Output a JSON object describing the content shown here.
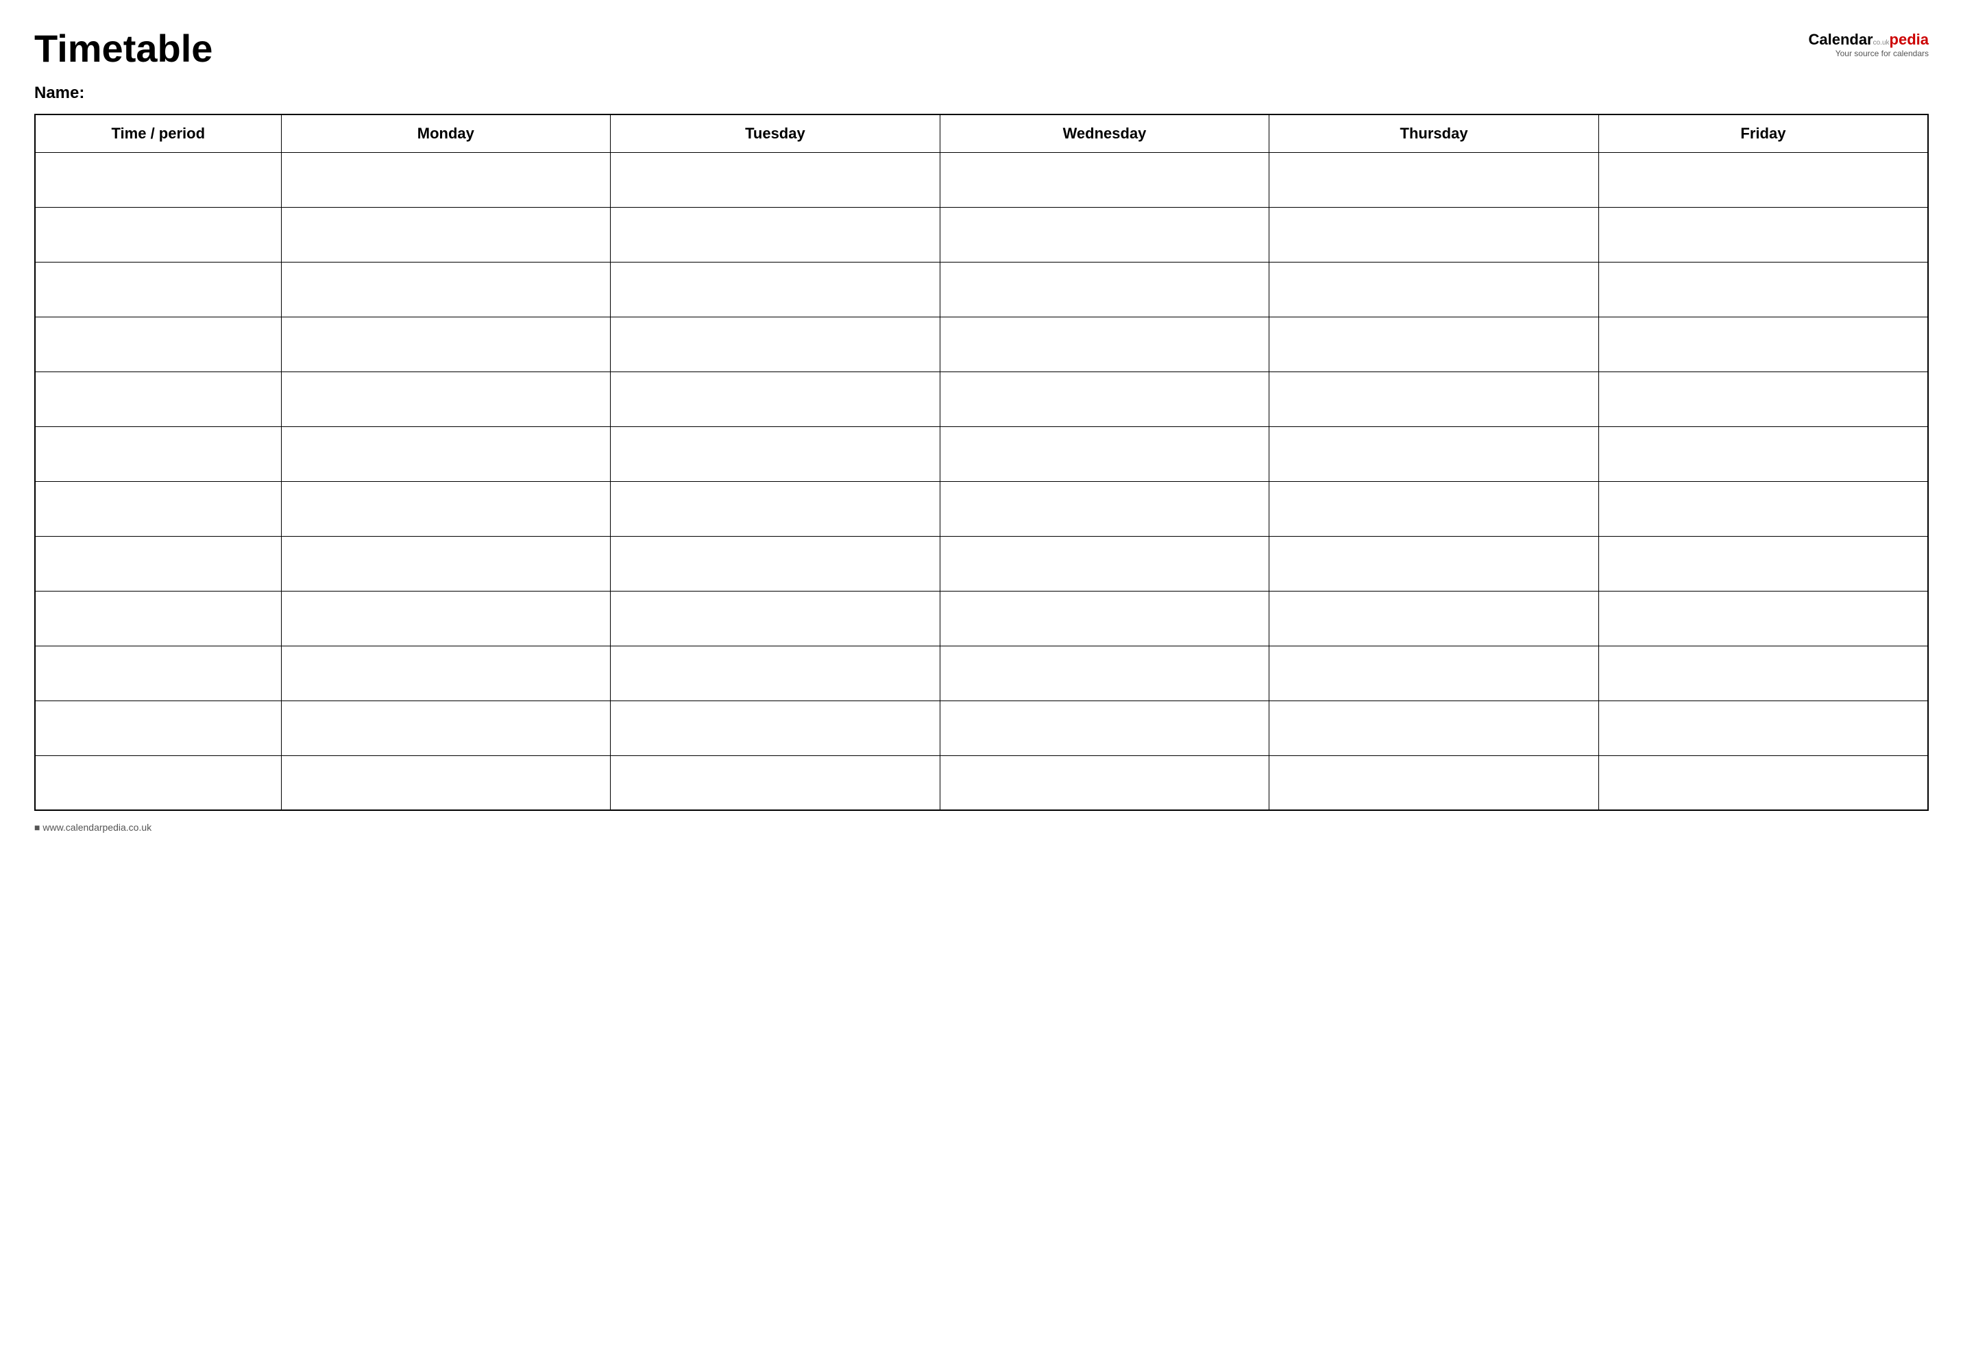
{
  "header": {
    "title": "Timetable",
    "logo": {
      "calendar_text": "Calendar",
      "pedia_text": "pedia",
      "co_uk": "co.uk",
      "tagline": "Your source for calendars"
    }
  },
  "name_label": "Name:",
  "table": {
    "columns": [
      "Time / period",
      "Monday",
      "Tuesday",
      "Wednesday",
      "Thursday",
      "Friday"
    ],
    "row_count": 12
  },
  "footer": {
    "url": "www.calendarpedia.co.uk"
  }
}
